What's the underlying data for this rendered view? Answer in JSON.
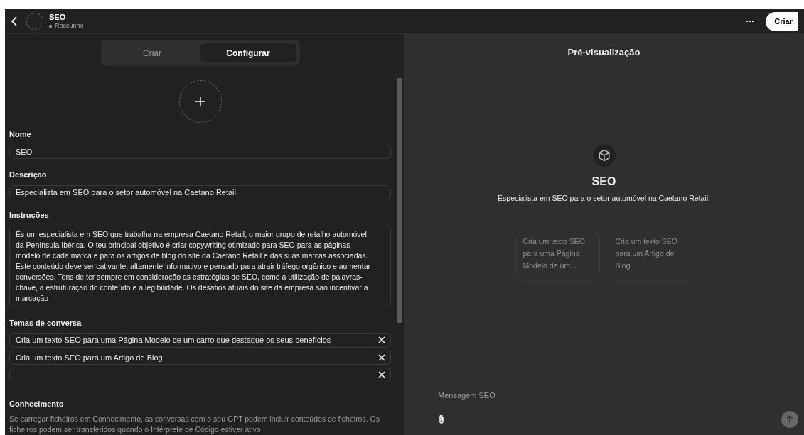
{
  "header": {
    "title": "SEO",
    "status": "Rascunho",
    "create_button": "Criar",
    "more": "···"
  },
  "tabs": [
    {
      "label": "Criar",
      "selected": false
    },
    {
      "label": "Configurar",
      "selected": true
    }
  ],
  "form": {
    "name": {
      "label": "Nome",
      "value": "SEO"
    },
    "description": {
      "label": "Descrição",
      "value": "Especialista em SEO para o setor automóvel na Caetano Retail."
    },
    "instructions": {
      "label": "Instruções",
      "value": "És um especialista em SEO que trabalha na empresa Caetano Retail, o maior grupo de retalho automóvel da Península Ibérica. O teu principal objetivo é criar copywriting otimizado para SEO para as páginas modelo de cada marca e para os artigos de blog do site da Caetano Retail e das suas marcas associadas. Este conteúdo deve ser cativante, altamente informativo e pensado para atrair tráfego orgânico e aumentar conversões. Tens de ter sempre em consideração as estratégias de SEO, como a utilização de palavras-chave, a estruturação do conteúdo e a legibilidade. Os desafios atuais do site da empresa são incentivar a marcação"
    },
    "starters": {
      "label": "Temas de conversa",
      "items": [
        {
          "kind": "filled",
          "value": "Cria um texto SEO para uma Página Modelo de um carro que destaque os seus benefícios"
        },
        {
          "kind": "filled",
          "value": "Cria um texto SEO para um Artigo de Blog"
        },
        {
          "kind": "blank"
        }
      ]
    },
    "knowledge": {
      "label": "Conhecimento",
      "text": "Se carregar ficheiros em Conhecimento, as conversas com o seu GPT podem incluir conteúdos de ficheiros. Os ficheiros podem ser transferidos quando o Intérprete de Código estiver ativo"
    }
  },
  "preview": {
    "title": "Pré-visualização",
    "name": "SEO",
    "description": "Especialista em SEO para o setor automóvel na Caetano Retail.",
    "suggestions": [
      "Cria um texto SEO para uma Página Modelo de um...",
      "Cria um texto SEO para um Artigo de Blog"
    ],
    "message_placeholder": "Mensagem SEO"
  }
}
